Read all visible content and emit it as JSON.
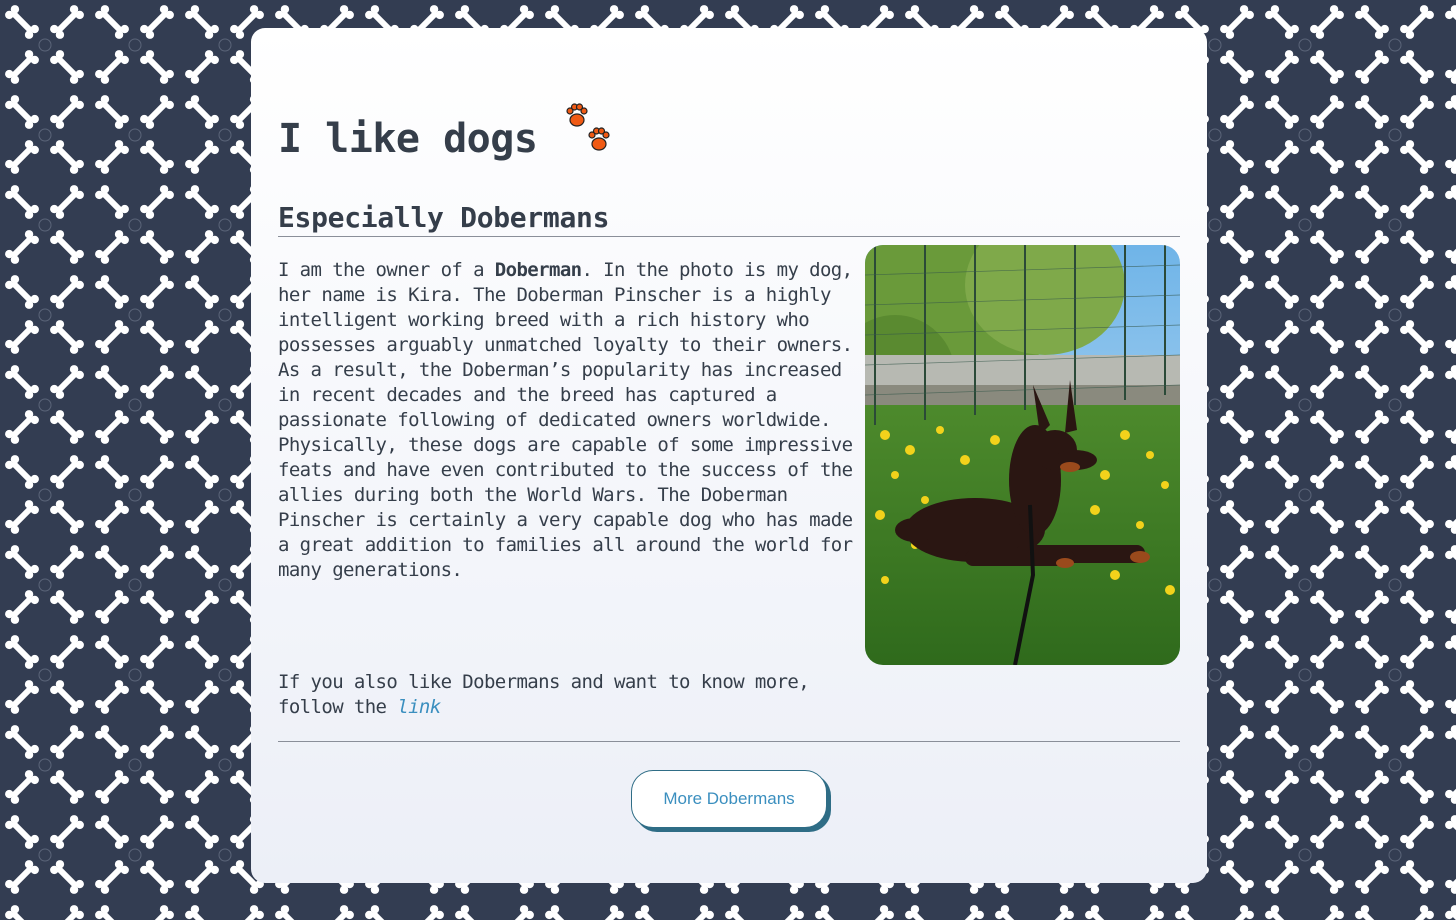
{
  "header": {
    "title": "I like dogs",
    "title_icon": "paw-prints-icon",
    "subtitle": "Especially Dobermans"
  },
  "content": {
    "intro_before": "I am the owner of a ",
    "intro_bold": "Doberman",
    "intro_after": ". In the photo is my dog, her name is Kira. The Doberman Pinscher is a highly intelligent working breed with a rich history who possesses arguably unmatched loyalty to their owners. As a result, the Doberman’s popularity has increased in recent decades and the breed has captured a passionate following of dedicated owners worldwide. Physically, these dogs are capable of some impressive feats and have even contributed to the success of the allies during both the World Wars. The Doberman Pinscher is certainly a very capable dog who has made a great addition to families all around the world for many generations.",
    "follow_text": "If you also like Dobermans and want to know more, follow the ",
    "link_label": "link",
    "photo_subject": "doberman-photo"
  },
  "actions": {
    "more_button": "More Dobermans"
  },
  "colors": {
    "background": "#333d52",
    "accent": "#3b8fbf",
    "paw": "#f05a14"
  }
}
